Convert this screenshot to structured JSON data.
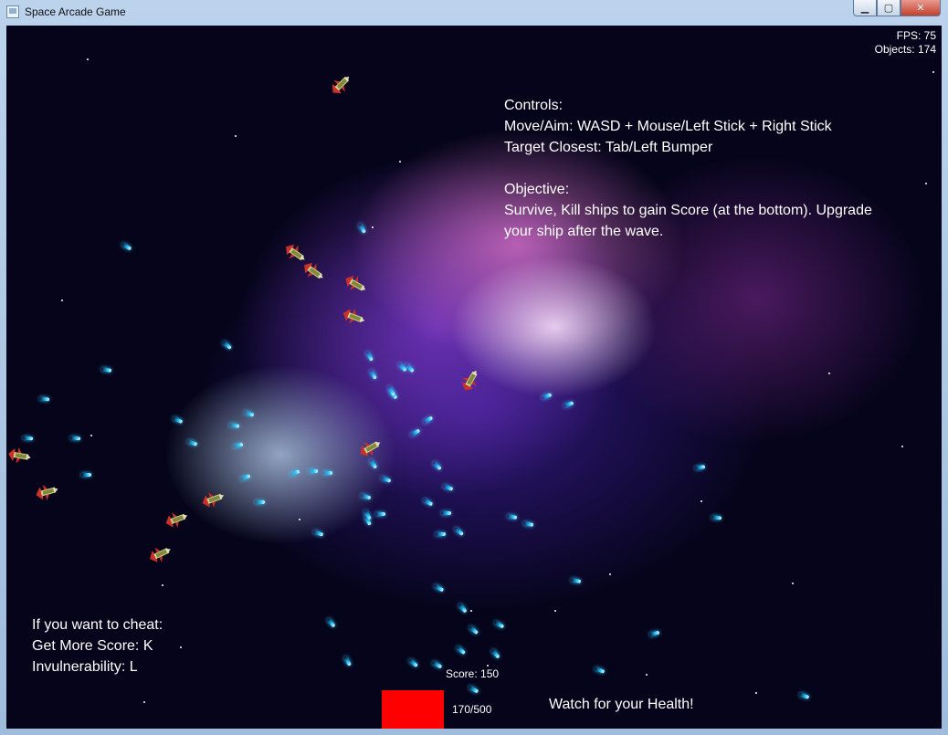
{
  "window": {
    "title": "Space Arcade Game",
    "buttons": {
      "minimize": "▁",
      "maximize": "▢",
      "close": "✕"
    }
  },
  "hud": {
    "fps": "FPS: 75",
    "objects": "Objects: 174",
    "score": "Score: 150",
    "health": {
      "text": "170/500",
      "current": 170,
      "max": 500,
      "color": "#ff0000"
    },
    "warning": "Watch for your Health!"
  },
  "info": {
    "controls_title": "Controls:",
    "move": "Move/Aim: WASD + Mouse/Left Stick + Right Stick",
    "target": "Target Closest: Tab/Left Bumper",
    "objective_title": "Objective:",
    "objective_1": "Survive, Kill ships to gain Score (at the bottom). Upgrade",
    "objective_2": "your ship after the wave."
  },
  "cheats": {
    "title": "If you want to cheat:",
    "score": "Get More Score: K",
    "invuln": "Invulnerability: L"
  },
  "colors": {
    "projectile": "#20c6ff",
    "enemy_ship": "#c8302a"
  },
  "sprites": {
    "enemy": "enemy-ship-icon",
    "projectile": "plasma-bolt-icon"
  }
}
